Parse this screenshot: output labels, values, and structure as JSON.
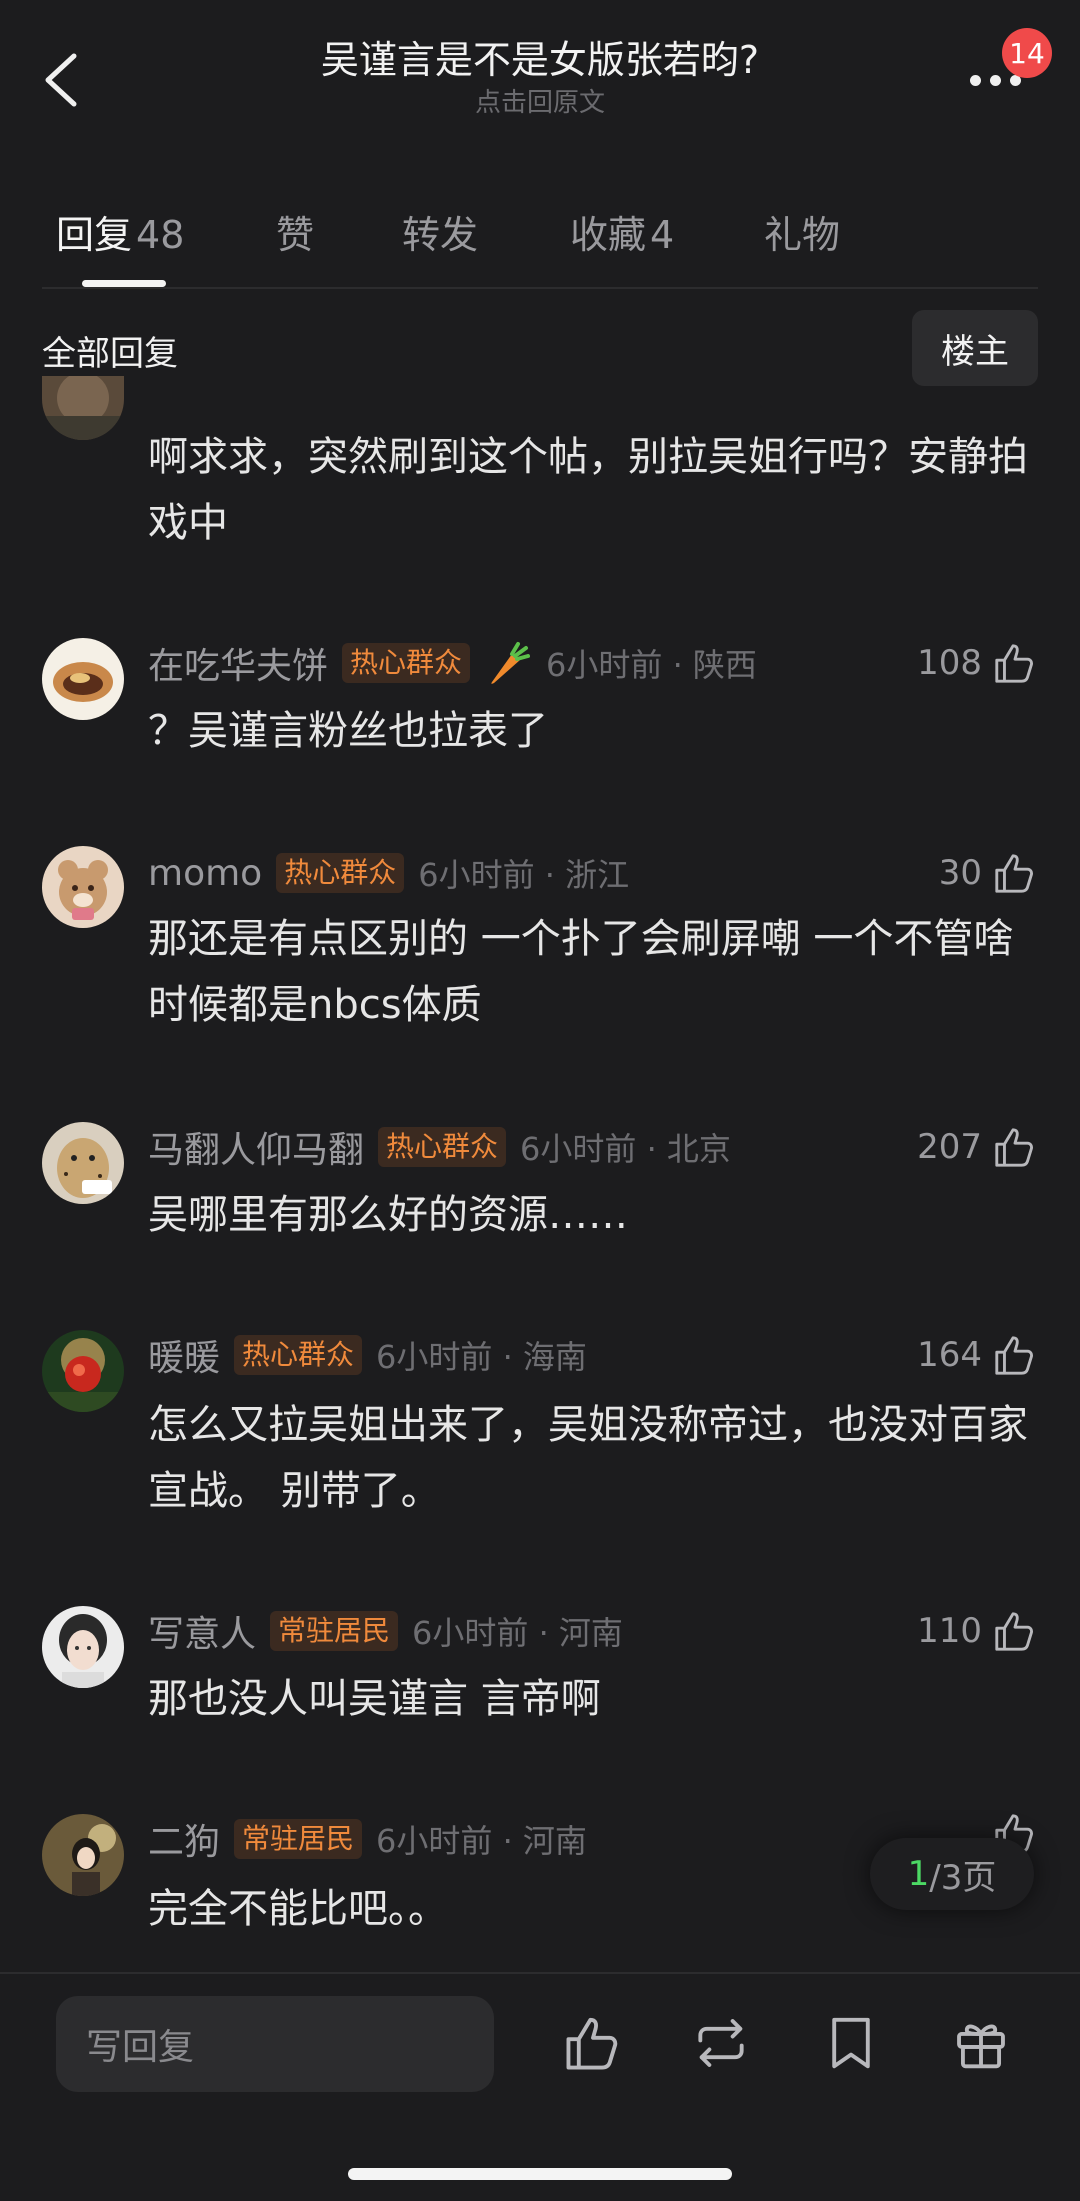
{
  "header": {
    "title": "吴谨言是不是女版张若昀?",
    "subtitle": "点击回原文",
    "notification_count": "14"
  },
  "tabs": [
    {
      "label": "回复",
      "count": "48",
      "active": true
    },
    {
      "label": "赞",
      "count": ""
    },
    {
      "label": "转发",
      "count": ""
    },
    {
      "label": "收藏",
      "count": "4"
    },
    {
      "label": "礼物",
      "count": ""
    }
  ],
  "section": {
    "title": "全部回复",
    "op_button": "楼主"
  },
  "comments": [
    {
      "content": "啊求求，突然刷到这个帖，别拉吴姐行吗？安静拍戏中"
    },
    {
      "username": "在吃华夫饼",
      "tag": "热心群众",
      "time": "6小时前 · 陕西",
      "likes": "108",
      "content": "？吴谨言粉丝也拉表了"
    },
    {
      "username": "momo",
      "tag": "热心群众",
      "time": "6小时前 · 浙江",
      "likes": "30",
      "content": "那还是有点区别的 一个扑了会刷屏嘲 一个不管啥时候都是nbcs体质"
    },
    {
      "username": "马翻人仰马翻",
      "tag": "热心群众",
      "time": "6小时前 · 北京",
      "likes": "207",
      "content": "吴哪里有那么好的资源……"
    },
    {
      "username": "暖暖",
      "tag": "热心群众",
      "time": "6小时前 · 海南",
      "likes": "164",
      "content": "怎么又拉吴姐出来了，吴姐没称帝过，也没对百家宣战。 别带了。"
    },
    {
      "username": "写意人",
      "tag": "常驻居民",
      "time": "6小时前 · 河南",
      "likes": "110",
      "content": "那也没人叫吴谨言 言帝啊"
    },
    {
      "username": "二狗",
      "tag": "常驻居民",
      "time": "6小时前 · 河南",
      "likes": "",
      "content": "完全不能比吧。。"
    }
  ],
  "pagination": {
    "current": "1",
    "total": "/3页"
  },
  "bottom_bar": {
    "reply_placeholder": "写回复"
  },
  "icons": {
    "back": "chevron-left-icon",
    "more": "more-dots-icon",
    "like": "thumbs-up-icon",
    "repost": "repost-icon",
    "bookmark": "bookmark-icon",
    "gift": "gift-icon",
    "carrot": "carrot-icon"
  },
  "colors": {
    "background": "#1c1c1e",
    "tag_text": "#f08a3c",
    "tag_bg": "#3b2a20",
    "badge": "#f04a4a",
    "page_current": "#4cd964"
  }
}
